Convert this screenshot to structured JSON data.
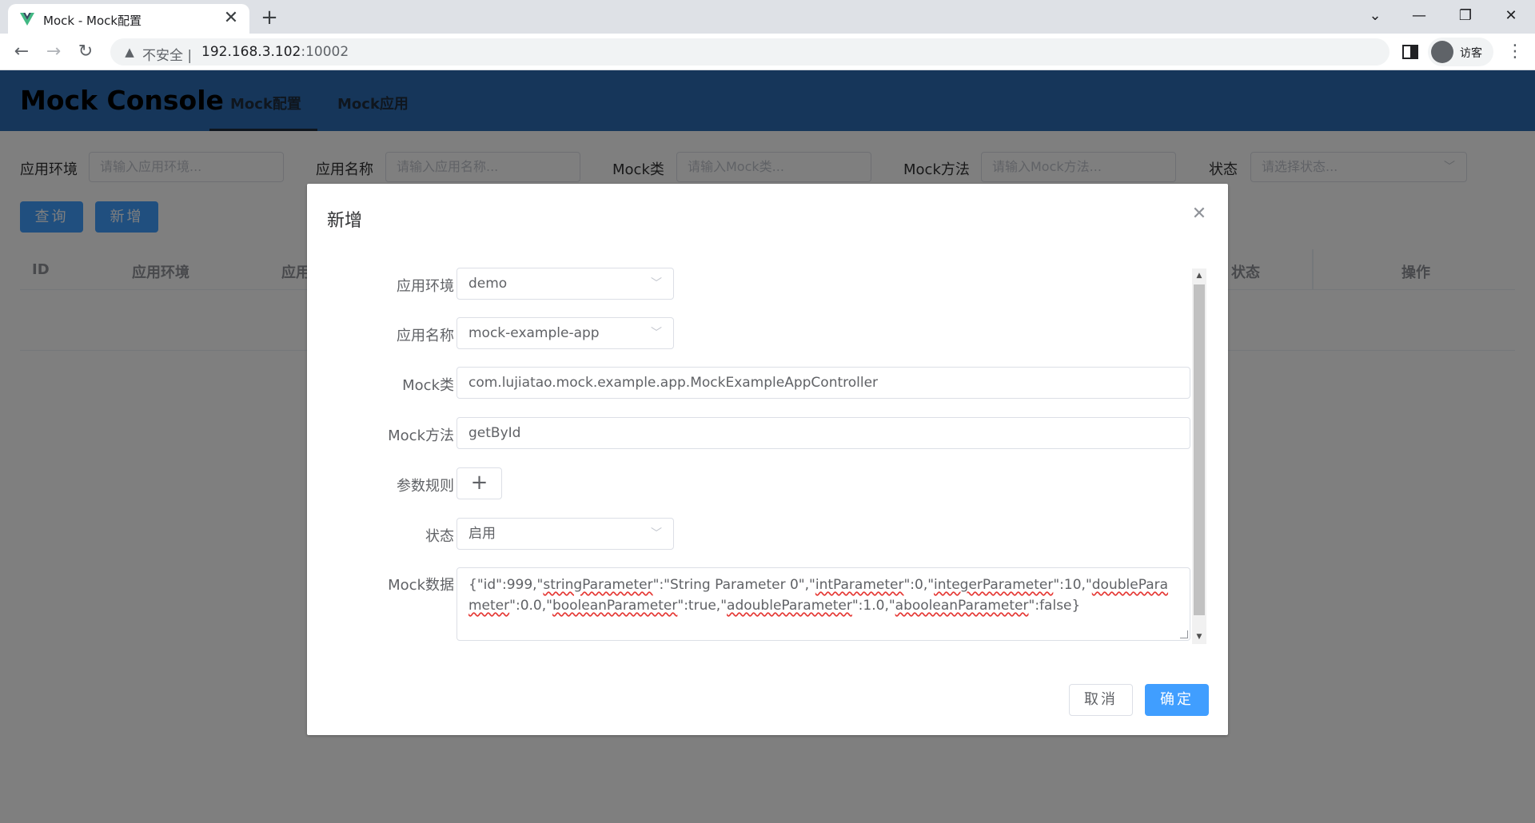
{
  "browser": {
    "tab_title": "Mock - Mock配置",
    "tab_close": "✕",
    "new_tab": "+",
    "insecure_label": "不安全",
    "url_host": "192.168.3.102",
    "url_port": ":10002",
    "profile_name": "访客",
    "controls": {
      "dropdown": "⌄",
      "minimize": "—",
      "restore": "❐",
      "close": "✕"
    }
  },
  "app": {
    "logo": "Mock Console",
    "nav": [
      {
        "label": "Mock配置",
        "active": true
      },
      {
        "label": "Mock应用",
        "active": false
      }
    ]
  },
  "filters": [
    {
      "label": "应用环境",
      "placeholder": "请输入应用环境..."
    },
    {
      "label": "应用名称",
      "placeholder": "请输入应用名称..."
    },
    {
      "label": "Mock类",
      "placeholder": "请输入Mock类..."
    },
    {
      "label": "Mock方法",
      "placeholder": "请输入Mock方法..."
    },
    {
      "label": "状态",
      "placeholder": "请选择状态..."
    }
  ],
  "actions": {
    "query": "查询",
    "add": "新增"
  },
  "table": {
    "headers": [
      "ID",
      "应用环境",
      "应用",
      "状态",
      "操作"
    ]
  },
  "dialog": {
    "title": "新增",
    "close": "✕",
    "fields": {
      "env": {
        "label": "应用环境",
        "value": "demo"
      },
      "app_name": {
        "label": "应用名称",
        "value": "mock-example-app"
      },
      "mock_class": {
        "label": "Mock类",
        "value": "com.lujiatao.mock.example.app.MockExampleAppController"
      },
      "mock_method": {
        "label": "Mock方法",
        "value": "getById"
      },
      "param_rules": {
        "label": "参数规则",
        "add": "+"
      },
      "status": {
        "label": "状态",
        "value": "启用"
      },
      "mock_data": {
        "label": "Mock数据",
        "parts": [
          "{\"id\":999,\"",
          "stringParameter",
          "\":\"String Parameter 0\",\"",
          "intParameter",
          "\":0,\"",
          "integerParameter",
          "\":10,\"",
          "doubleParameter",
          "\":0.0,\"",
          "booleanParameter",
          "\":true,\"",
          "adoubleParameter",
          "\":1.0,\"",
          "abooleanParameter",
          "\":false}"
        ]
      }
    },
    "buttons": {
      "cancel": "取消",
      "confirm": "确定"
    }
  },
  "colors": {
    "header": "#2d6cb5",
    "primary": "#409eff"
  }
}
